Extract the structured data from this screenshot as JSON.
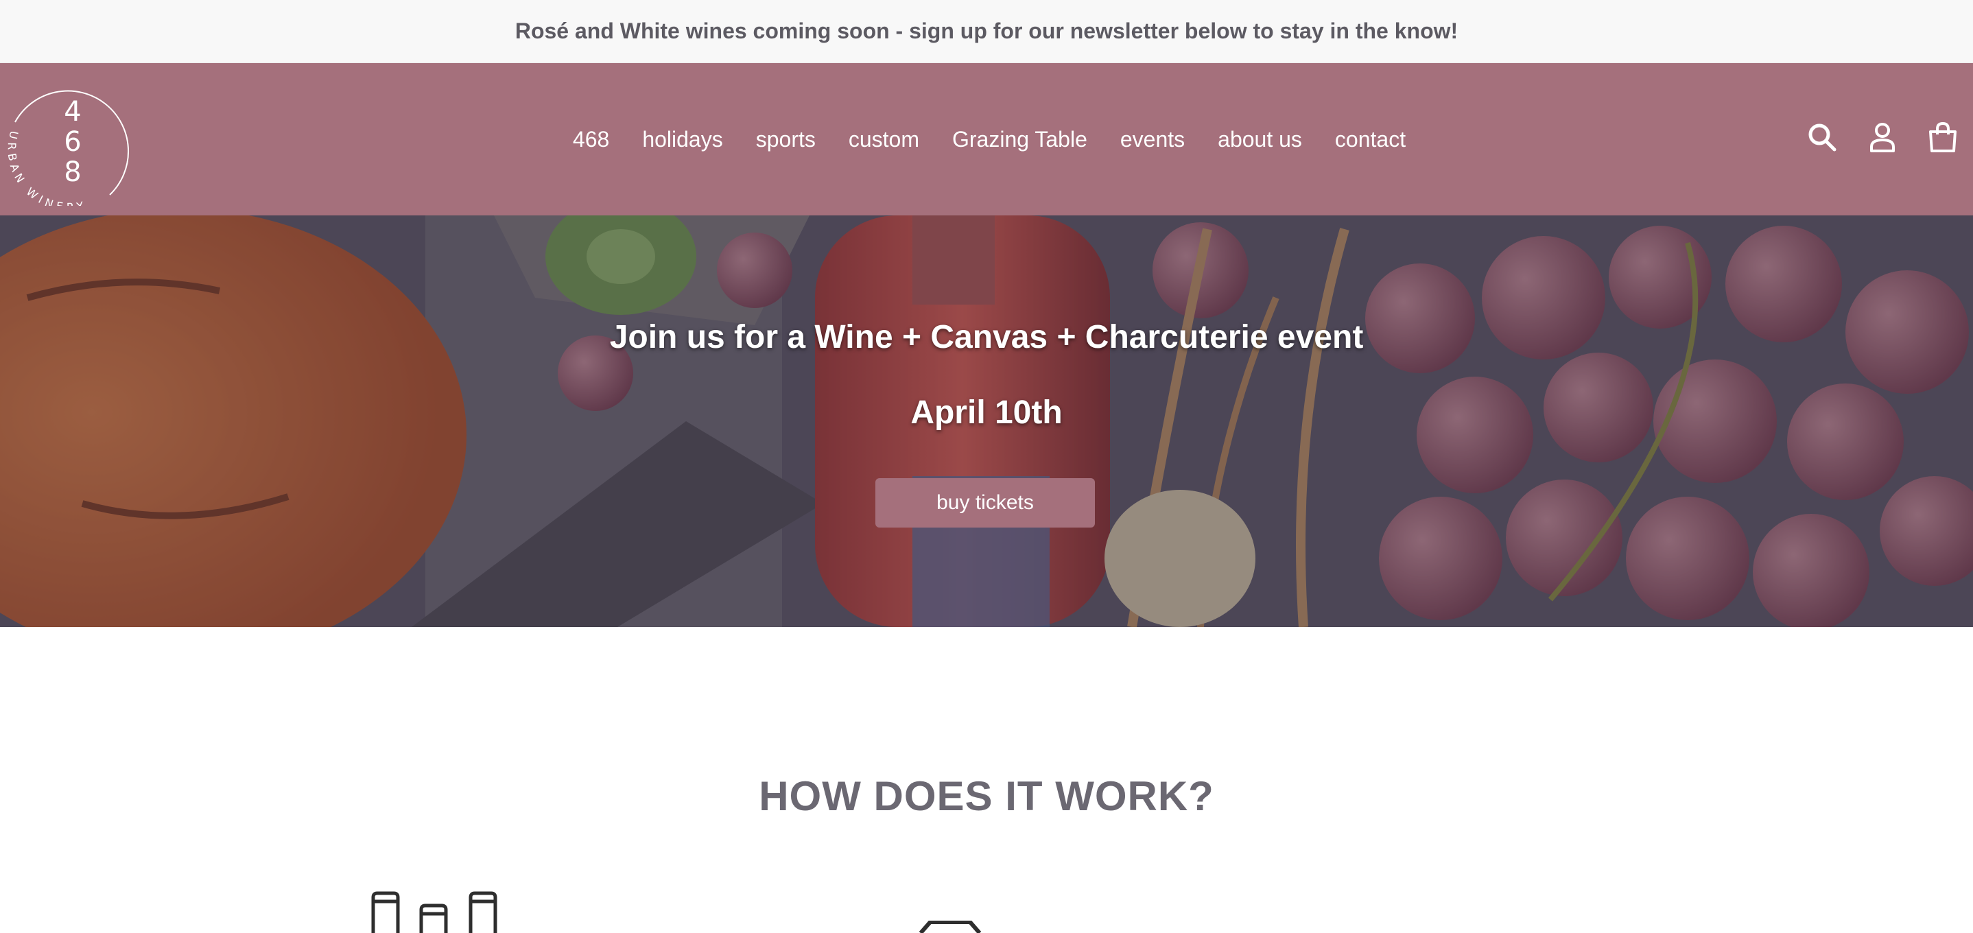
{
  "announcement": {
    "text": "Rosé and White wines coming soon - sign up for our newsletter below to stay in the know!"
  },
  "header": {
    "logo": {
      "number": [
        "4",
        "6",
        "8"
      ],
      "text": "URBAN WINERY"
    },
    "nav": [
      "468",
      "holidays",
      "sports",
      "custom",
      "Grazing Table",
      "events",
      "about us",
      "contact"
    ],
    "icons": [
      "search-icon",
      "account-icon",
      "cart-icon"
    ]
  },
  "hero": {
    "title": "Join us for a Wine + Canvas + Charcuterie event",
    "subtitle": "April 10th",
    "button_label": "buy tickets"
  },
  "how": {
    "title": "HOW DOES IT WORK?"
  },
  "colors": {
    "brand": "#a5707c",
    "announcement_bg": "#f8f8f8",
    "heading": "#6b6872"
  }
}
